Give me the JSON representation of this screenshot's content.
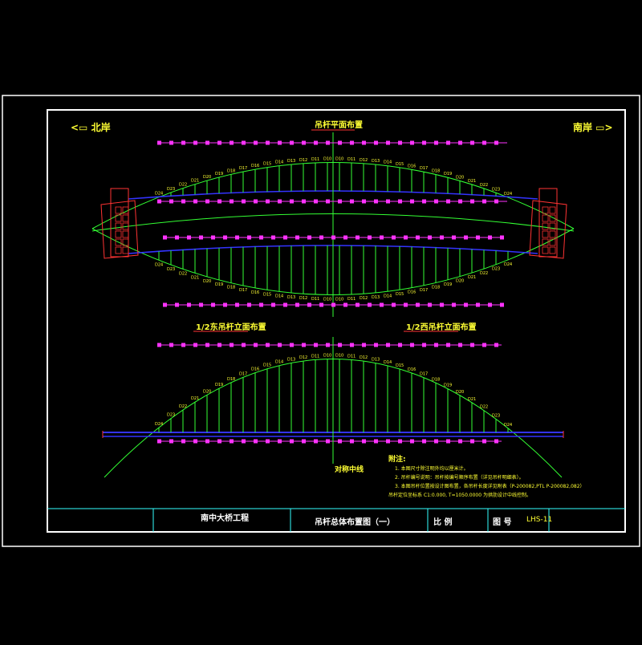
{
  "banks": {
    "north": "<▭ 北岸",
    "south": "南岸 ▭>"
  },
  "plan_title": "吊杆平面布置",
  "elev_east": "1/2东吊杆立面布置",
  "elev_west": "1/2西吊杆立面布置",
  "center_mark": "对称中线",
  "top_hanger_labels": [
    "D24",
    "D23",
    "D22",
    "D21",
    "D20",
    "D19",
    "D18",
    "D17",
    "D16",
    "D15",
    "D14",
    "D13",
    "D12",
    "D11",
    "D10",
    "D10",
    "D11",
    "D12",
    "D13",
    "D14",
    "D15",
    "D16",
    "D17",
    "D18",
    "D19",
    "D20",
    "D21",
    "D22",
    "D23",
    "D24"
  ],
  "elev_labels": [
    "D24",
    "D23",
    "D22",
    "D21",
    "D20",
    "D19",
    "D18",
    "D17",
    "D16",
    "D15",
    "D14",
    "D13",
    "D12",
    "D11",
    "D10",
    "D10",
    "D11",
    "D12",
    "D13",
    "D14",
    "D15",
    "D16",
    "D17",
    "D18",
    "D19",
    "D20",
    "D21",
    "D22",
    "D23",
    "D24"
  ],
  "notes": {
    "heading": "附注:",
    "lines": [
      "1. 本图尺寸除注明外均以厘米计。",
      "2. 吊杆编号说明：吊杆按编号顺序布置（详见吊杆明细表）。",
      "3. 本图吊杆位置按设计图布置，各吊杆长度详见附表（P-200082,PTL P-200082,082）",
      "吊杆定位坐标系 C1:0.000, T=1050.0000 为拱肋设计中线控制。"
    ]
  },
  "title_block": {
    "project": "南中大桥工程",
    "drawing": "吊杆总体布置图（一）",
    "scale_label": "比 例",
    "number_label": "图 号",
    "number_value": "LHS-11"
  },
  "colors": {
    "frame": "#ffffff",
    "block": "#33ffff",
    "arch": "#33ff33",
    "deck": "#3333ff",
    "hanger": "#33ff33",
    "dims": "#ff33ff",
    "pier": "#ff3333",
    "text": "#ffff33"
  }
}
